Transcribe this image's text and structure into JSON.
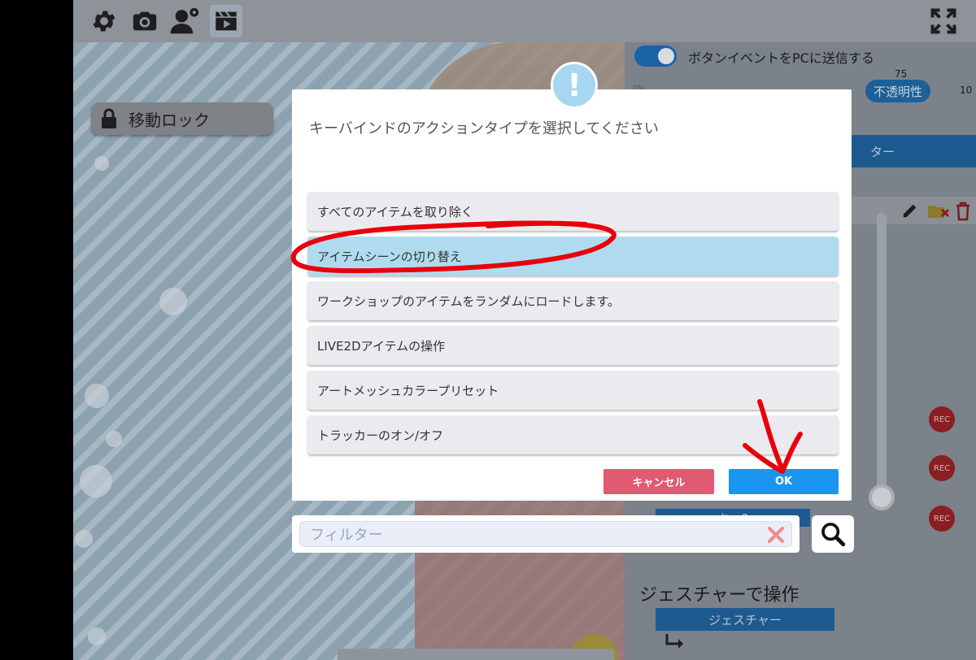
{
  "toolbar": {
    "icons": [
      "gear-icon",
      "camera-icon",
      "user-settings-icon",
      "clapperboard-icon",
      "fullscreen-icon"
    ]
  },
  "stage": {
    "move_lock_label": "移動ロック"
  },
  "panel": {
    "send_button_event_label": "ボタンイベントをPCに送信する",
    "opacity_value": "75",
    "opacity_label": "不透明性",
    "range_min_partial": "0%",
    "range_max_partial": "10",
    "filter_partial": "ター",
    "blue_button_partial": "キー?",
    "rec_label": "REC",
    "gesture_heading": "ジェスチャーで操作",
    "gesture_button": "ジェスチャー"
  },
  "modal": {
    "alert_symbol": "!",
    "title": "キーバインドのアクションタイプを選択してください",
    "options": [
      "すべてのアイテムを取り除く",
      "アイテムシーンの切り替え",
      "ワークショップのアイテムをランダムにロードします。",
      "LIVE2Dアイテムの操作",
      "アートメッシュカラープリセット",
      "トラッカーのオン/オフ"
    ],
    "selected_index": 1,
    "cancel_label": "キャンセル",
    "ok_label": "OK"
  },
  "filter": {
    "placeholder": "フィルター"
  },
  "colors": {
    "selected_option": "#b0dbef",
    "cancel": "#e05a72",
    "ok": "#1a96f0",
    "annotation": "#e8000b"
  }
}
